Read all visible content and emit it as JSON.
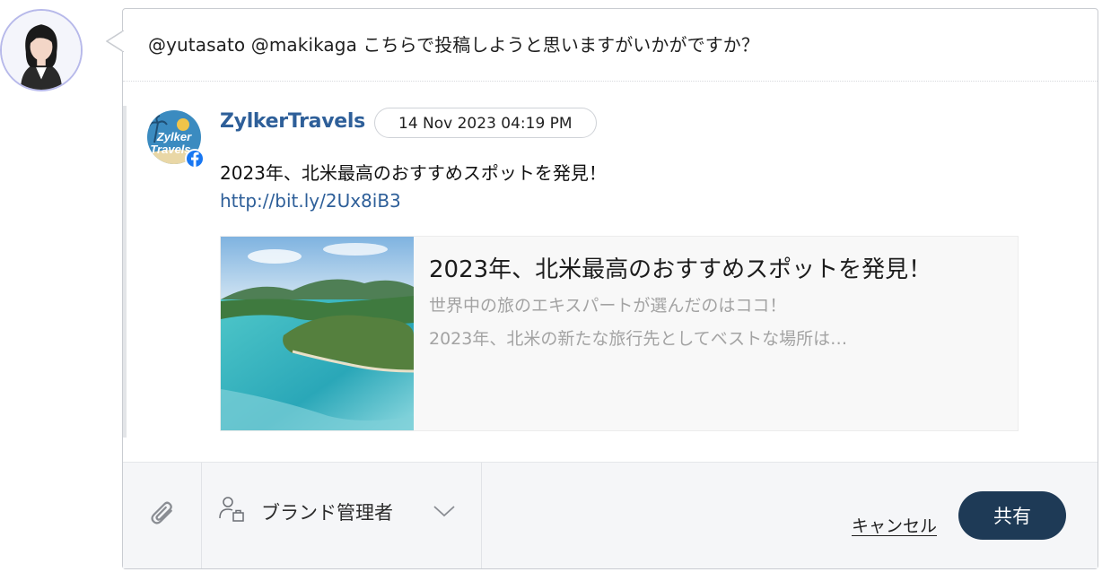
{
  "comment": {
    "text": "@yutasato @makikaga  こちらで投稿しようと思いますがいかがですか？"
  },
  "post": {
    "account_name": "ZylkerTravels",
    "timestamp": "14 Nov 2023 04:19 PM",
    "text": "2023年、北米最高のおすすめスポットを発見！",
    "link": "http://bit.ly/2Ux8iB3",
    "network_icon": "facebook-icon",
    "logo_text": [
      "Zylker",
      "Travels"
    ]
  },
  "preview": {
    "title": "2023年、北米最高のおすすめスポットを発見！",
    "description_line1": "世界中の旅のエキスパートが選んだのはココ！",
    "description_line2": "2023年、北米の新たな旅行先としてベストな場所は…"
  },
  "footer": {
    "role_label": "ブランド管理者",
    "cancel_label": "キャンセル",
    "share_label": "共有"
  },
  "colors": {
    "accent": "#2e5f99",
    "share_button": "#1e3a56",
    "facebook": "#1877f2"
  }
}
